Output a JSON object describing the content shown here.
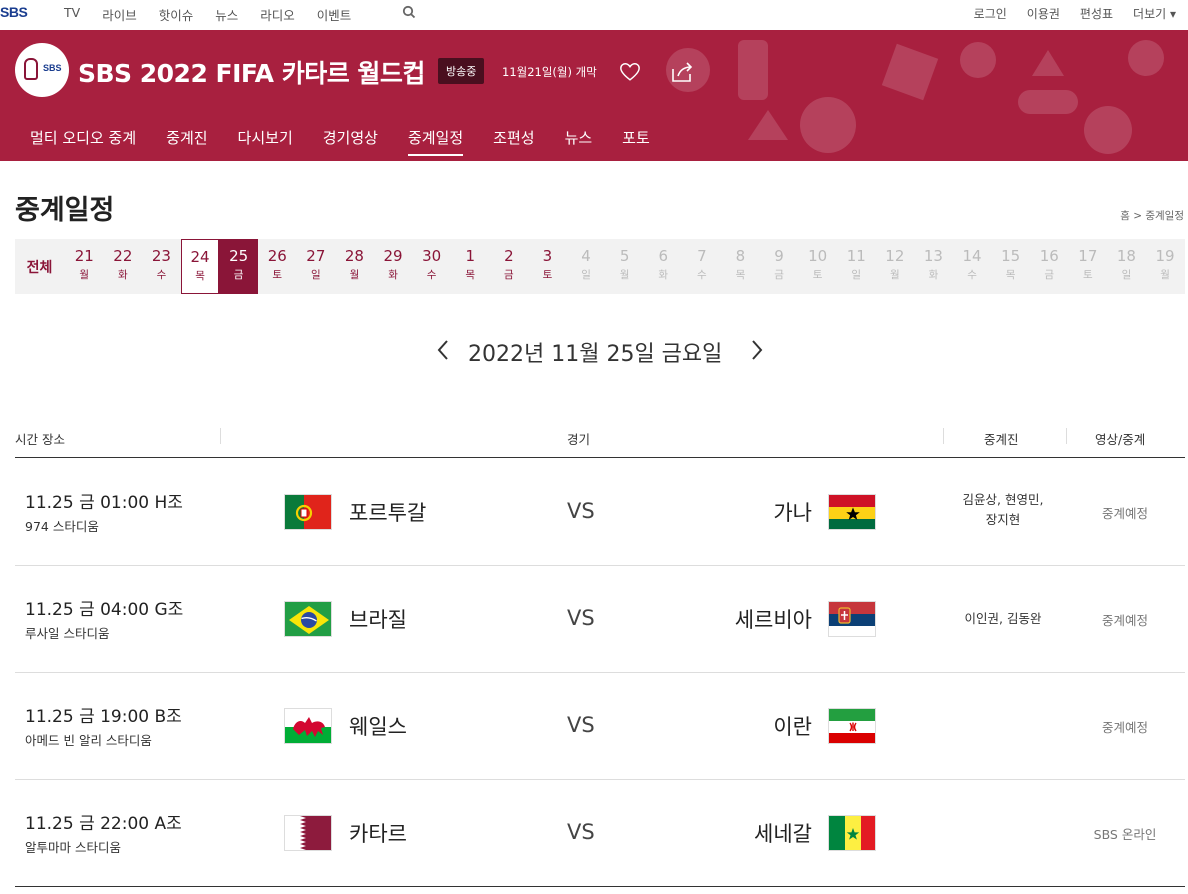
{
  "top_nav": {
    "logo": "SBS",
    "left_items": [
      "TV",
      "라이브",
      "핫이슈",
      "뉴스",
      "라디오",
      "이벤트"
    ],
    "right_items": [
      "로그인",
      "이용권",
      "편성표",
      "더보기 ▾"
    ]
  },
  "banner": {
    "emblem_text": "SBS",
    "title": "SBS 2022 FIFA 카타르 월드컵",
    "live_chip": "방송중",
    "open_date": "11월21일(월) 개막",
    "tabs": [
      "멀티 오디오 중계",
      "중계진",
      "다시보기",
      "경기영상",
      "중계일정",
      "조편성",
      "뉴스",
      "포토"
    ],
    "active_tab_index": 4,
    "color": "#a8203f"
  },
  "page": {
    "title": "중계일정",
    "breadcrumb": "홈 > 중계일정"
  },
  "date_bar": {
    "all_label": "전체",
    "accent_color": "#8a1538",
    "selected_index": 4,
    "outlined_index": 3,
    "days": [
      {
        "d": "21",
        "w": "월"
      },
      {
        "d": "22",
        "w": "화"
      },
      {
        "d": "23",
        "w": "수"
      },
      {
        "d": "24",
        "w": "목"
      },
      {
        "d": "25",
        "w": "금"
      },
      {
        "d": "26",
        "w": "토"
      },
      {
        "d": "27",
        "w": "일"
      },
      {
        "d": "28",
        "w": "월"
      },
      {
        "d": "29",
        "w": "화"
      },
      {
        "d": "30",
        "w": "수"
      },
      {
        "d": "1",
        "w": "목"
      },
      {
        "d": "2",
        "w": "금"
      },
      {
        "d": "3",
        "w": "토"
      },
      {
        "d": "4",
        "w": "일"
      },
      {
        "d": "5",
        "w": "월"
      },
      {
        "d": "6",
        "w": "화"
      },
      {
        "d": "7",
        "w": "수"
      },
      {
        "d": "8",
        "w": "목"
      },
      {
        "d": "9",
        "w": "금"
      },
      {
        "d": "10",
        "w": "토"
      },
      {
        "d": "11",
        "w": "일"
      },
      {
        "d": "12",
        "w": "월"
      },
      {
        "d": "13",
        "w": "화"
      },
      {
        "d": "14",
        "w": "수"
      },
      {
        "d": "15",
        "w": "목"
      },
      {
        "d": "16",
        "w": "금"
      },
      {
        "d": "17",
        "w": "토"
      },
      {
        "d": "18",
        "w": "일"
      },
      {
        "d": "19",
        "w": "월"
      }
    ],
    "active_count": 13
  },
  "date_heading": "2022년 11월 25일 금요일",
  "table": {
    "headers": {
      "time_venue": "시간 장소",
      "match": "경기",
      "casters": "중계진",
      "video": "영상/중계"
    },
    "vs_label": "VS",
    "rows": [
      {
        "time": "11.25 금  01:00  H조",
        "venue": "974 스타디움",
        "home": "포르투갈",
        "home_flag": "portugal-flag-icon",
        "away": "가나",
        "away_flag": "ghana-flag-icon",
        "casters": [
          "김윤상, 현영민,",
          "장지현"
        ],
        "status": "중계예정"
      },
      {
        "time": "11.25 금  04:00  G조",
        "venue": "루사일 스타디움",
        "home": "브라질",
        "home_flag": "brazil-flag-icon",
        "away": "세르비아",
        "away_flag": "serbia-flag-icon",
        "casters": [
          "이인권, 김동완"
        ],
        "status": "중계예정"
      },
      {
        "time": "11.25 금  19:00  B조",
        "venue": "아메드 빈 알리 스타디움",
        "home": "웨일스",
        "home_flag": "wales-flag-icon",
        "away": "이란",
        "away_flag": "iran-flag-icon",
        "casters": [],
        "status": "중계예정"
      },
      {
        "time": "11.25 금  22:00  A조",
        "venue": "알투마마 스타디움",
        "home": "카타르",
        "home_flag": "qatar-flag-icon",
        "away": "세네갈",
        "away_flag": "senegal-flag-icon",
        "casters": [],
        "status": "SBS 온라인"
      }
    ]
  }
}
